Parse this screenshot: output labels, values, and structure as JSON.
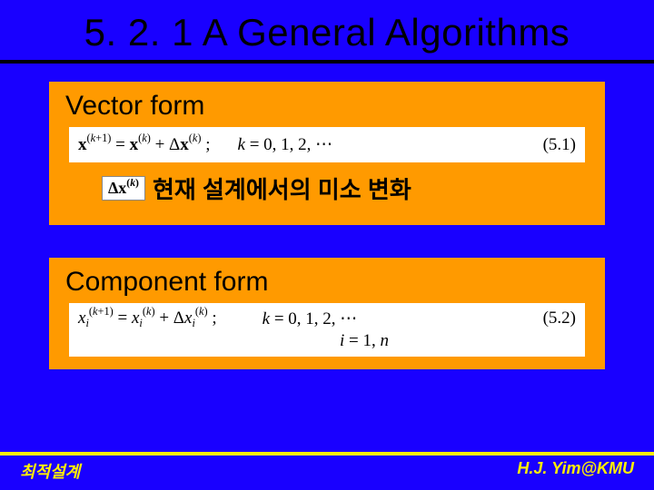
{
  "title": "5. 2. 1 A General Algorithms",
  "panel1": {
    "heading": "Vector form",
    "eq_lhs_html": "<span class='vec'>x</span><span class='sup'>(<span class='it'>k</span>+1)</span> = <span class='vec'>x</span><span class='sup'>(<span class='it'>k</span>)</span> + Δ<span class='vec'>x</span><span class='sup'>(<span class='it'>k</span>)</span> ;",
    "eq_mid_html": "<span class='it'>k</span> = 0, 1, 2, ⋯",
    "eq_num": "(5.1)",
    "note_symbol_html": "Δ<span class='vec'>x</span><span class='sup'>(<span class='it'>k</span>)</span>",
    "note_text": "현재 설계에서의 미소 변화"
  },
  "panel2": {
    "heading": "Component form",
    "eq_lhs_html": "<span class='it'>x</span><span class='sub'><span class='it'>i</span></span><span class='sup'>(<span class='it'>k</span>+1)</span> = <span class='it'>x</span><span class='sub'><span class='it'>i</span></span><span class='sup'>(<span class='it'>k</span>)</span> + Δ<span class='it'>x</span><span class='sub'><span class='it'>i</span></span><span class='sup'>(<span class='it'>k</span>)</span> ;",
    "eq_mid_line1_html": "<span class='it'>k</span> = 0, 1, 2, ⋯",
    "eq_mid_line2_html": "<span class='it'>i</span> = 1, <span class='it'>n</span>",
    "eq_num": "(5.2)"
  },
  "footer": {
    "left": "최적설계",
    "right": "H.J. Yim@KMU"
  }
}
